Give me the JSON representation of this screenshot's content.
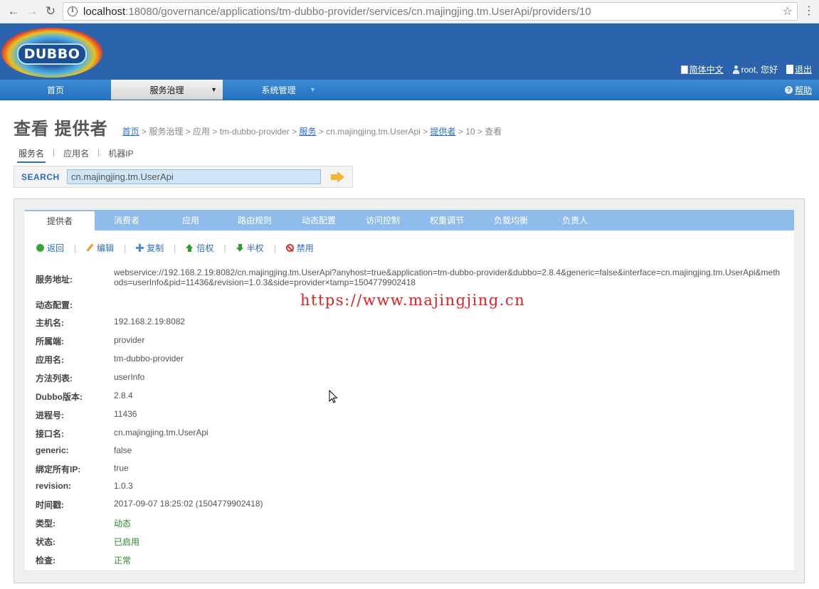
{
  "browser": {
    "url_host": "localhost",
    "url_path": ":18080/governance/applications/tm-dubbo-provider/services/cn.majingjing.tm.UserApi/providers/10"
  },
  "header": {
    "logo_text": "DUBBO",
    "lang_label": "简体中文",
    "user_label": "root, 您好",
    "logout_label": "退出"
  },
  "mainnav": {
    "home": "首页",
    "governance": "服务治理",
    "system": "系统管理",
    "help": "帮助"
  },
  "page": {
    "title": "查看 提供者",
    "breadcrumb": [
      {
        "text": "首页",
        "link": true
      },
      {
        "text": " > 服务治理 > 应用 > tm-dubbo-provider > ",
        "link": false
      },
      {
        "text": "服务",
        "link": true
      },
      {
        "text": " > cn.majingjing.tm.UserApi > ",
        "link": false
      },
      {
        "text": "提供者",
        "link": true
      },
      {
        "text": " > 10 > 查看",
        "link": false
      }
    ]
  },
  "search": {
    "filters": [
      "服务名",
      "应用名",
      "机器IP"
    ],
    "label": "SEARCH",
    "value": "cn.majingjing.tm.UserApi"
  },
  "tabs": [
    "提供者",
    "消费者",
    "应用",
    "路由规则",
    "动态配置",
    "访问控制",
    "权重调节",
    "负载均衡",
    "负责人"
  ],
  "actions": [
    {
      "label": "返回",
      "icon": "back-icon"
    },
    {
      "label": "编辑",
      "icon": "edit-icon"
    },
    {
      "label": "复制",
      "icon": "copy-icon"
    },
    {
      "label": "倍权",
      "icon": "double-weight-icon"
    },
    {
      "label": "半权",
      "icon": "half-weight-icon"
    },
    {
      "label": "禁用",
      "icon": "disable-icon"
    }
  ],
  "details": [
    {
      "key": "服务地址:",
      "value": "webservice://192.168.2.19:8082/cn.majingjing.tm.UserApi?anyhost=true&application=tm-dubbo-provider&dubbo=2.8.4&generic=false&interface=cn.majingjing.tm.UserApi&methods=userInfo&pid=11436&revision=1.0.3&side=provider×tamp=1504779902418"
    },
    {
      "key": "动态配置:",
      "value": ""
    },
    {
      "key": "主机名:",
      "value": "192.168.2.19:8082"
    },
    {
      "key": "所属端:",
      "value": "provider"
    },
    {
      "key": "应用名:",
      "value": "tm-dubbo-provider"
    },
    {
      "key": "方法列表:",
      "value": "userInfo"
    },
    {
      "key": "Dubbo版本:",
      "value": "2.8.4"
    },
    {
      "key": "进程号:",
      "value": "11436"
    },
    {
      "key": "接口名:",
      "value": "cn.majingjing.tm.UserApi"
    },
    {
      "key": "generic:",
      "value": "false"
    },
    {
      "key": "绑定所有IP:",
      "value": "true"
    },
    {
      "key": "revision:",
      "value": "1.0.3"
    },
    {
      "key": "时间戳:",
      "value": "2017-09-07 18:25:02 (1504779902418)"
    },
    {
      "key": "类型:",
      "value": "动态"
    },
    {
      "key": "状态:",
      "value": "已启用"
    },
    {
      "key": "检查:",
      "value": "正常"
    }
  ],
  "status_colors": {
    "green_value": "#2a8a2a"
  },
  "watermark": "https://www.majingjing.cn"
}
